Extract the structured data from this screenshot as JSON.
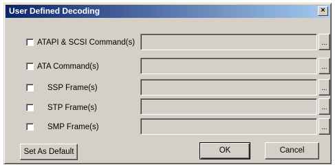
{
  "window": {
    "title": "User Defined Decoding",
    "close_glyph": "×"
  },
  "rows": [
    {
      "label": "ATAPI & SCSI Command(s)",
      "value": "",
      "checked": false,
      "browse_label": "..."
    },
    {
      "label": "ATA Command(s)",
      "value": "",
      "checked": false,
      "browse_label": "..."
    },
    {
      "label": "SSP Frame(s)",
      "value": "",
      "checked": false,
      "browse_label": "..."
    },
    {
      "label": "STP Frame(s)",
      "value": "",
      "checked": false,
      "browse_label": "..."
    },
    {
      "label": "SMP Frame(s)",
      "value": "",
      "checked": false,
      "browse_label": "..."
    }
  ],
  "buttons": {
    "set_default": "Set As Default",
    "ok": "OK",
    "cancel": "Cancel"
  },
  "colors": {
    "face": "#d4d0c8",
    "title_start": "#0a246a",
    "title_end": "#a6caf0"
  }
}
